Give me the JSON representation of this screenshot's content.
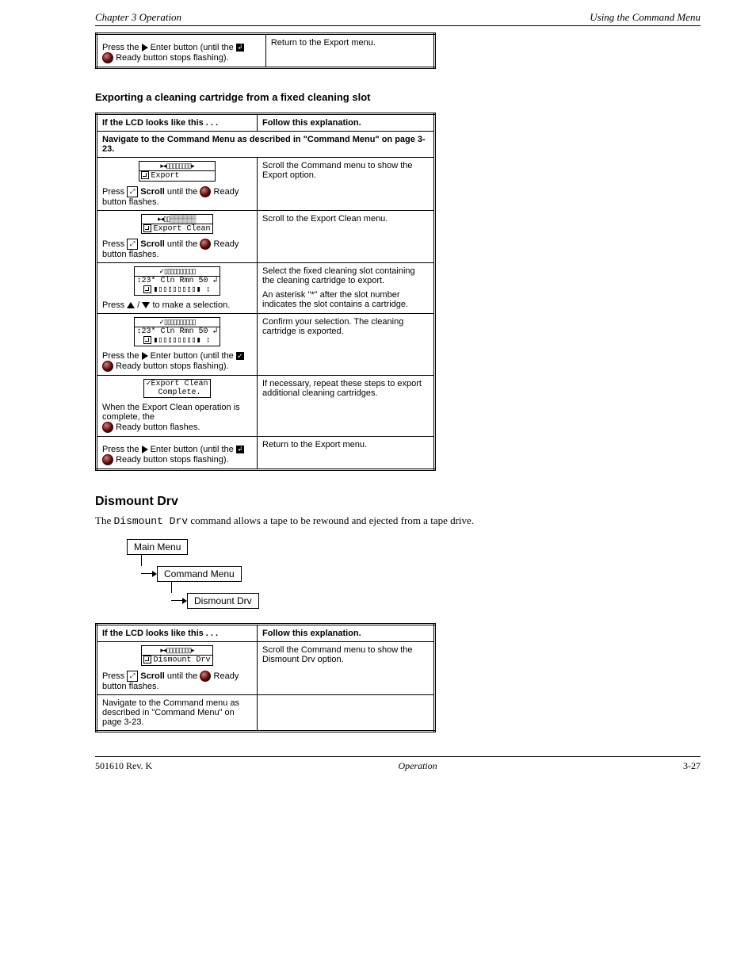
{
  "header": {
    "left": "Chapter 3  Operation",
    "right": "Using the Command Menu"
  },
  "footer": {
    "left": "501610 Rev. K",
    "mid": "Operation",
    "right": "3-27"
  },
  "table0": {
    "row10": {
      "op_prefix": "Press the ",
      "op_btn": "Enter",
      "op_mid": " button (until the ",
      "op_end": " button stops flashing).",
      "led": "Ready",
      "expl": "Return to the Export menu."
    }
  },
  "caption1": "Exporting a cleaning cartridge from a fixed cleaning slot",
  "table1": {
    "h_lcd": "If the LCD looks like this . . .",
    "h_expl": "Follow this explanation.",
    "h_banner": "Navigate to the Command Menu as described in \"Command Menu\" on page 3-23.",
    "row1": {
      "lcd1": "Export",
      "op_prefix": "Press ",
      "op_mid": " until the ",
      "op_end": " button flashes.",
      "scroll": "Scroll",
      "led": "Ready",
      "expl": "Scroll the Command menu to show the Export option."
    },
    "row2": {
      "lcd1": "Export Clean",
      "op_prefix": "Press ",
      "op_mid": " until the ",
      "op_end": " button flashes.",
      "scroll": "Scroll",
      "led": "Ready",
      "expl": "Scroll to the Export Clean menu."
    },
    "row3": {
      "lcd1": "23* Cln Rmn 50",
      "op_prefix": "Press ",
      "op_mid": " / ",
      "op_end": " to make a selection.",
      "led": "",
      "expl_a": "Select the fixed cleaning slot containing the cleaning cartridge to export.",
      "expl_b": "An asterisk \"*\" after the slot number indicates the slot contains a cartridge."
    },
    "row4": {
      "lcd1": "23* Cln Rmn 50",
      "op_prefix": "Press the ",
      "op_btn": "Enter",
      "op_mid": " button (until the ",
      "op_end": " button stops flashing).",
      "led": "Ready",
      "expl": "Confirm your selection. The cleaning cartridge is exported."
    },
    "row5": {
      "lcd0": "Export Clean",
      "lcd1": "Complete.",
      "op_prefix": "When the Export Clean operation is complete, the ",
      "op_end": " button flashes.",
      "led": "Ready",
      "expl": "If necessary, repeat these steps to export additional cleaning cartridges."
    },
    "row6": {
      "op_prefix": "Press the ",
      "op_btn": "Enter",
      "op_mid": " button (until the ",
      "op_end": " button stops flashing).",
      "led": "Ready",
      "expl": "Return to the Export menu."
    }
  },
  "section2": {
    "title": "Dismount Drv",
    "para": "The Dismount Drv command allows a tape to be rewound and ejected from a tape drive.",
    "flow": {
      "n1": "Main Menu",
      "n2": "Command Menu",
      "n3": "Dismount Drv"
    }
  },
  "table2": {
    "h_lcd": "If the LCD looks like this . . .",
    "h_expl": "Follow this explanation.",
    "row1": {
      "lcd1": "Dismount Drv",
      "op_prefix": "Press ",
      "op_mid": " until the ",
      "op_end": " button flashes.",
      "scroll": "Scroll",
      "led": "Ready",
      "expl": "Scroll the Command menu to show the Dismount Drv option."
    },
    "rowNavHint": "Navigate to the Command menu as described in \"Command Menu\" on page 3-23."
  }
}
